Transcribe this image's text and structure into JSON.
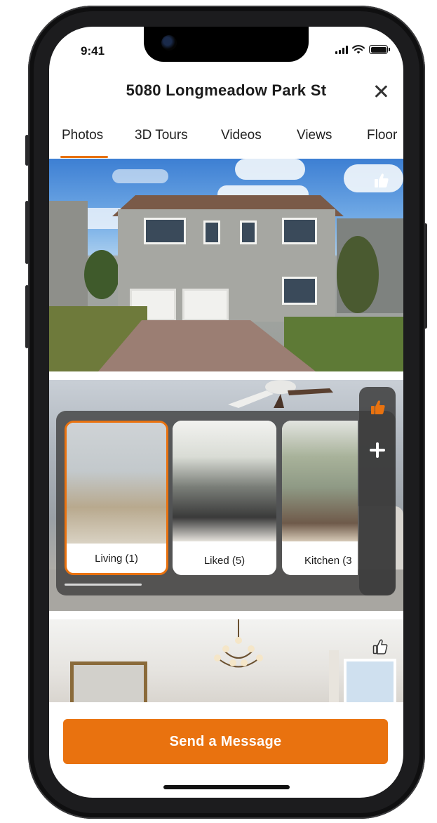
{
  "status_bar": {
    "time": "9:41"
  },
  "header": {
    "title": "5080 Longmeadow Park St"
  },
  "tabs": [
    {
      "label": "Photos",
      "active": true
    },
    {
      "label": "3D Tours"
    },
    {
      "label": "Videos"
    },
    {
      "label": "Views"
    },
    {
      "label": "Floor"
    }
  ],
  "room_cards": [
    {
      "label": "Living (1)",
      "selected": true
    },
    {
      "label": "Liked (5)"
    },
    {
      "label": "Kitchen (3"
    }
  ],
  "footer": {
    "send_label": "Send a Message"
  },
  "colors": {
    "accent": "#e9720f",
    "text": "#1b1b1b",
    "overlay": "#3c3c3c"
  },
  "icons": [
    "close-icon",
    "thumbs-up-icon",
    "plus-icon",
    "signal-icon",
    "wifi-icon",
    "battery-icon"
  ]
}
